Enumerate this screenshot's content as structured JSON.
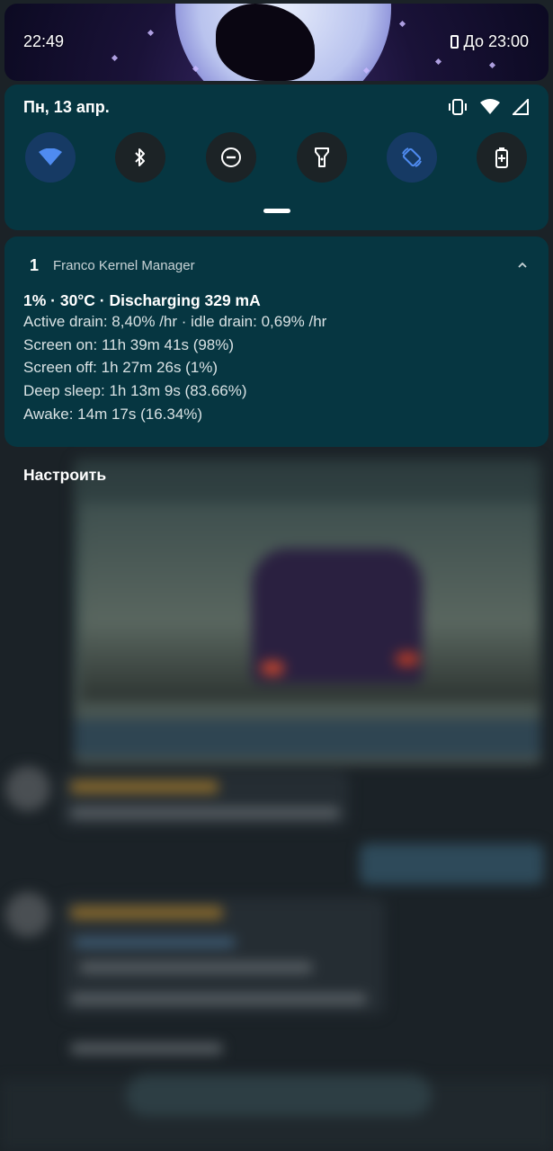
{
  "status_bar": {
    "time": "22:49",
    "alarm_text": "До 23:00",
    "alarm_icon": "phone-outline-icon"
  },
  "quick_settings": {
    "date": "Пн, 13 апр.",
    "status_icons": [
      "vibrate-icon",
      "wifi-icon",
      "signal-icon"
    ],
    "tiles": [
      {
        "name": "wifi-tile",
        "icon": "wifi-icon",
        "active": true
      },
      {
        "name": "bluetooth-tile",
        "icon": "bluetooth-icon",
        "active": false
      },
      {
        "name": "do-not-disturb-tile",
        "icon": "do-not-disturb-icon",
        "active": false
      },
      {
        "name": "flashlight-tile",
        "icon": "flashlight-icon",
        "active": false
      },
      {
        "name": "auto-rotate-tile",
        "icon": "auto-rotate-icon",
        "active": true
      },
      {
        "name": "battery-saver-tile",
        "icon": "battery-saver-icon",
        "active": false
      }
    ],
    "colors": {
      "panel": "#063641",
      "active_tile": "#163a64",
      "active_icon": "#4f8bf0",
      "inactive_tile": "#1c2326"
    }
  },
  "notification": {
    "app_icon": "1",
    "app_name": "Franco Kernel Manager",
    "title": "1% · 30°C · Discharging 329 mA",
    "lines": [
      "Active drain: 8,40% /hr · idle drain: 0,69% /hr",
      "Screen on: 11h 39m 41s  (98%)",
      "Screen off: 1h 27m 26s  (1%)",
      "Deep sleep: 1h 13m 9s  (83.66%)",
      "Awake: 14m 17s  (16.34%)"
    ]
  },
  "configure_label": "Настроить"
}
